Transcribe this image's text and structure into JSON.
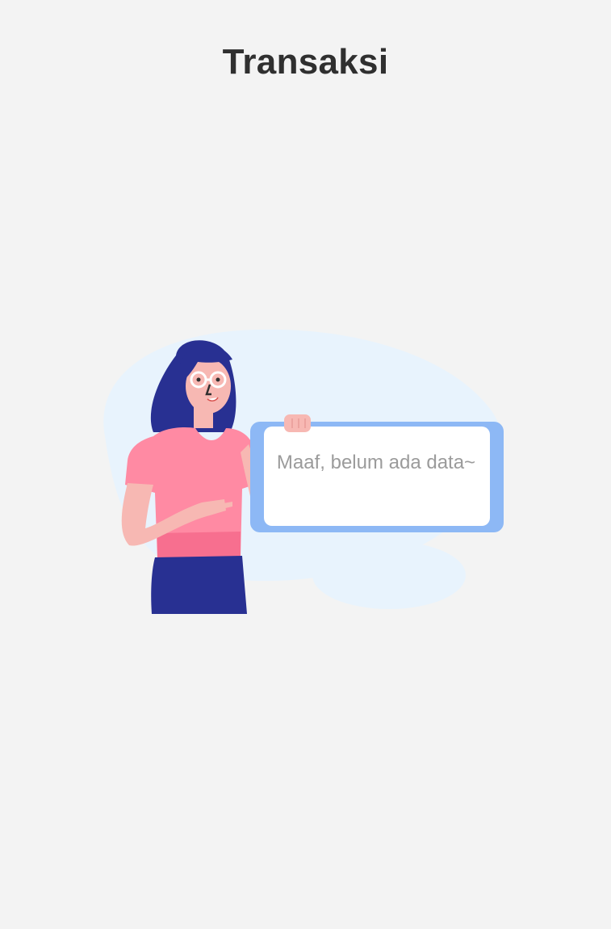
{
  "header": {
    "title": "Transaksi"
  },
  "empty_state": {
    "illustration_icon": "woman-holding-empty-sign-illustration",
    "message": "Maaf, belum ada data~"
  },
  "colors": {
    "background": "#f3f3f3",
    "title_text": "#2f2f2f",
    "message_text": "#9b9b9b",
    "blob": "#e8f3fd",
    "board_frame": "#8db8f5",
    "shirt": "#ff8aa3",
    "skirt": "#283092",
    "hair": "#283092"
  }
}
